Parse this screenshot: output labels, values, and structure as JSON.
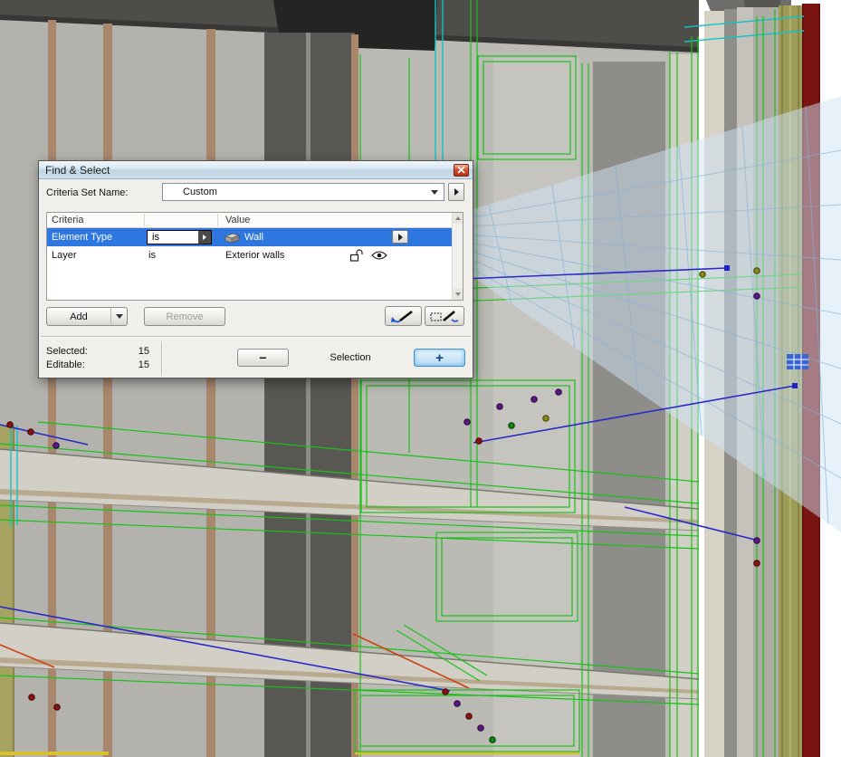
{
  "colors": {
    "selection_highlight_green": "#17c217",
    "selected_row_blue": "#2e76e0",
    "grid_plane_blue": "#cfe3f5",
    "close_button_red": "#d14a2c",
    "focused_plus_button": "#b4daf3",
    "dark_red_wall": "#7a1410",
    "olive_wall": "#9d9b58"
  },
  "dialog": {
    "title": "Find & Select",
    "criteria_set": {
      "label": "Criteria Set Name:",
      "value": "Custom"
    },
    "table": {
      "columns": [
        "Criteria",
        "Value"
      ],
      "rows": [
        {
          "criteria": "Element Type",
          "operator": "is",
          "value": "Wall"
        },
        {
          "criteria": "Layer",
          "operator": "is",
          "value": "Exterior walls"
        }
      ]
    },
    "buttons": {
      "add": "Add",
      "remove": "Remove"
    },
    "status": {
      "selected_label": "Selected:",
      "selected_value": "15",
      "editable_label": "Editable:",
      "editable_value": "15",
      "selection_label": "Selection",
      "minus_glyph": "−",
      "plus_glyph": "+"
    }
  }
}
